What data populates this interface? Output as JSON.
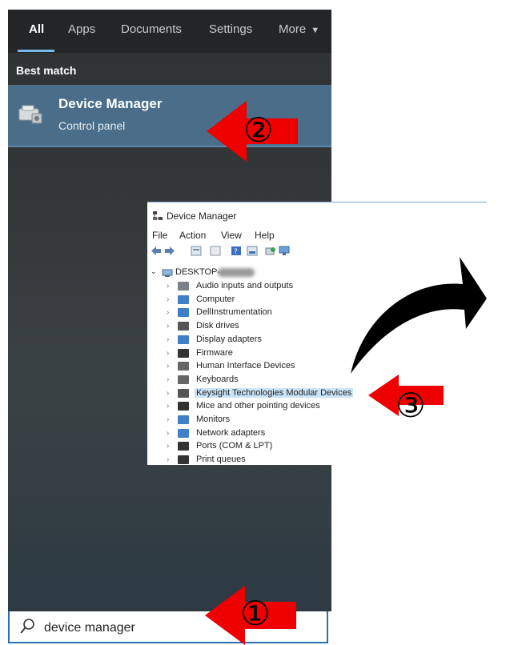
{
  "search_panel": {
    "tabs": [
      "All",
      "Apps",
      "Documents",
      "Settings",
      "More"
    ],
    "section_label": "Best match",
    "result": {
      "title": "Device Manager",
      "subtitle": "Control panel"
    },
    "search_query": "device manager"
  },
  "device_manager": {
    "title": "Device Manager",
    "menu": [
      "File",
      "Action",
      "View",
      "Help"
    ],
    "root": "DESKTOP-",
    "nodes": [
      "Audio inputs and outputs",
      "Computer",
      "DellInstrumentation",
      "Disk drives",
      "Display adapters",
      "Firmware",
      "Human Interface Devices",
      "Keyboards",
      "Keysight Technologies Modular Devices",
      "Mice and other pointing devices",
      "Monitors",
      "Network adapters",
      "Ports (COM & LPT)",
      "Print queues"
    ],
    "selected_index": 8
  },
  "annotations": {
    "step1": "①",
    "step2": "②",
    "step3": "③"
  },
  "colors": {
    "arrow": "#ee0000",
    "accent": "#76b9ed",
    "selection": "#cce4f7"
  },
  "icons": [
    "device-manager-icon",
    "search-icon",
    "red-arrow-icon",
    "curved-arrow-icon"
  ]
}
